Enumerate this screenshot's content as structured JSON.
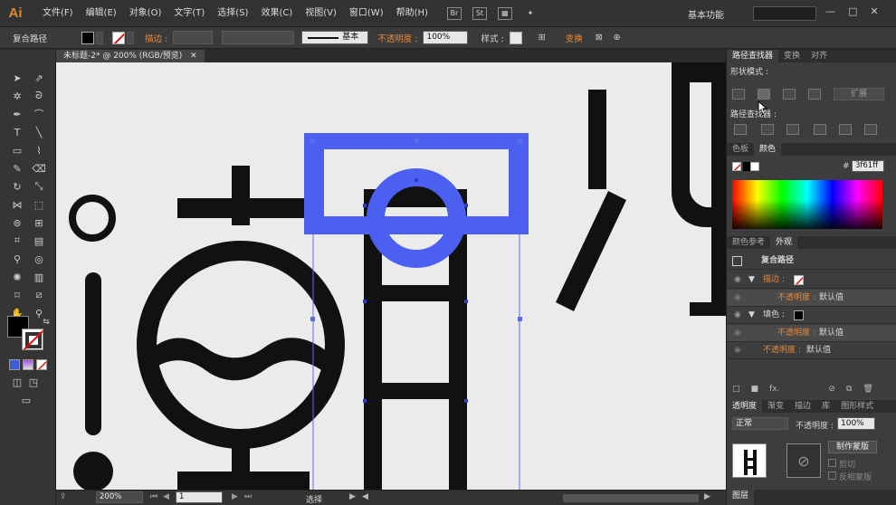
{
  "app": {
    "logo": "Ai",
    "workspace": "基本功能"
  },
  "menu": [
    "文件(F)",
    "编辑(E)",
    "对象(O)",
    "文字(T)",
    "选择(S)",
    "效果(C)",
    "视图(V)",
    "窗口(W)",
    "帮助(H)"
  ],
  "menu_icons": {
    "bridge": "Br",
    "stock": "St"
  },
  "control": {
    "object_type": "复合路径",
    "stroke_label": "描边 :",
    "brush_label": "基本",
    "opacity_label": "不透明度 :",
    "opacity_value": "100%",
    "style_label": "样式 :",
    "transform_label": "变换"
  },
  "document": {
    "tab": "未标题-2* @ 200% (RGB/预览)"
  },
  "status": {
    "zoom": "200%",
    "artboard": "1",
    "tool": "选择"
  },
  "pathfinder": {
    "tabs": [
      "路径查找器",
      "变换",
      "对齐"
    ],
    "shape_modes_label": "形状模式 :",
    "expand": "扩展",
    "pathfinders_label": "路径查找器 :"
  },
  "color_panel": {
    "tabs": [
      "色板",
      "颜色"
    ],
    "hex": "3f61ff"
  },
  "appearance": {
    "tabs": [
      "颜色参考",
      "外观"
    ],
    "object": "复合路径",
    "rows": [
      {
        "label": "描边 :",
        "indent": 1
      },
      {
        "label": "不透明度 :",
        "value": "默认值",
        "indent": 2
      },
      {
        "label": "填色 :",
        "indent": 1
      },
      {
        "label": "不透明度 :",
        "value": "默认值",
        "indent": 2
      },
      {
        "label": "不透明度 :",
        "value": "默认值",
        "indent": 1
      }
    ]
  },
  "transparency": {
    "tabs": [
      "透明度",
      "渐变",
      "描边",
      "库",
      "图形样式"
    ],
    "blend_mode": "正常",
    "opacity_label": "不透明度 :",
    "opacity_value": "100%",
    "make_mask": "制作蒙版",
    "clip": "剪切",
    "invert_mask": "反相蒙版"
  },
  "layers_tab": "图层",
  "colors": {
    "accent": "#3f61ff",
    "ui_orange": "#e7893a",
    "glyph": "#111111"
  }
}
